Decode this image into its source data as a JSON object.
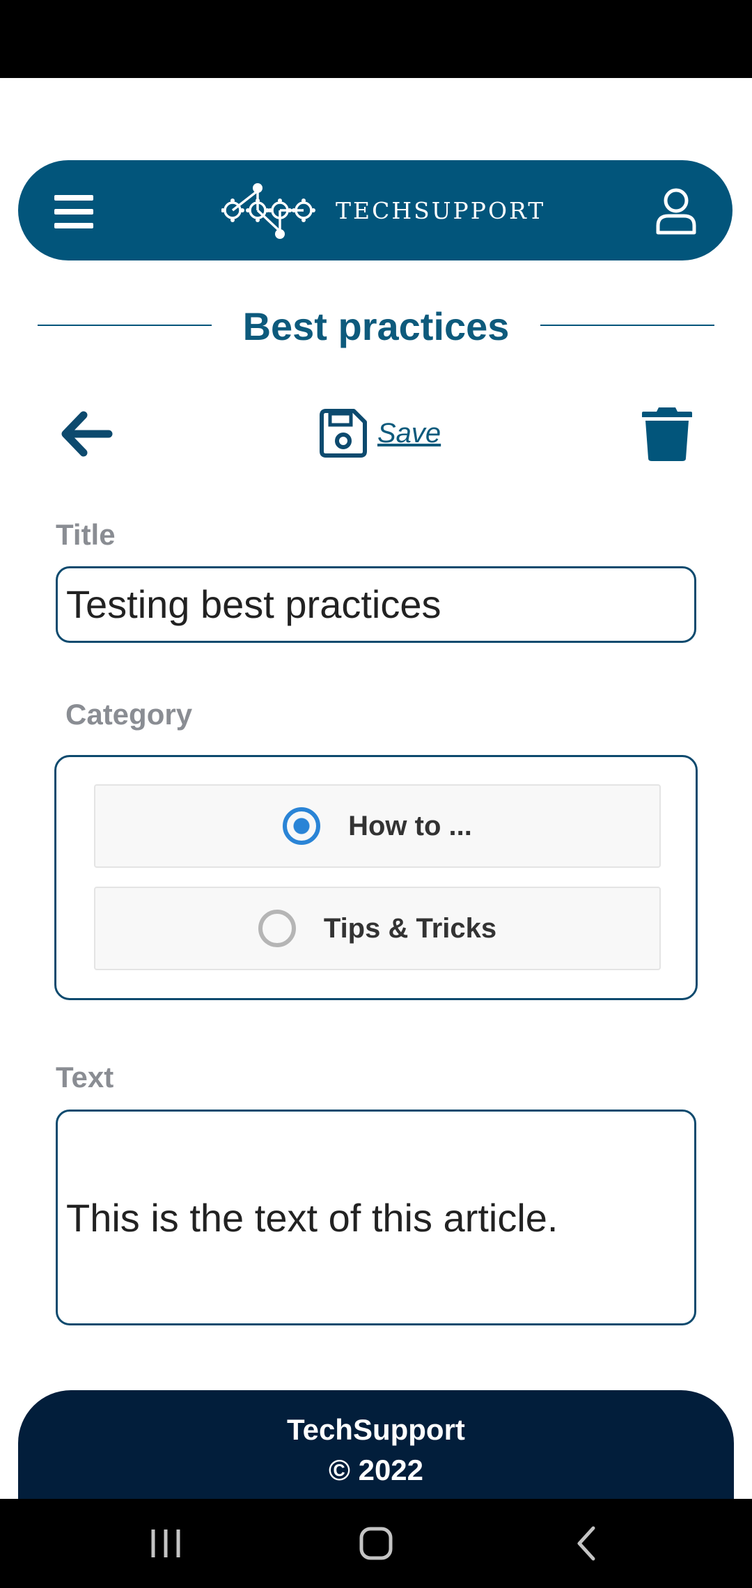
{
  "app": {
    "brand": "TECHSUPPORT",
    "page_title": "Best practices"
  },
  "toolbar": {
    "save_label": "Save"
  },
  "form": {
    "title_label": "Title",
    "title_value": "Testing best practices",
    "category_label": "Category",
    "category_options": [
      {
        "label": "How to ...",
        "selected": true
      },
      {
        "label": "Tips & Tricks",
        "selected": false
      }
    ],
    "text_label": "Text",
    "text_value": "This is the text of this article."
  },
  "footer": {
    "line1": "TechSupport",
    "line2": "© 2022"
  },
  "colors": {
    "header_bg": "#02557b",
    "footer_bg": "#021e3b",
    "accent": "#2a84d6",
    "title": "#0d5a7c"
  },
  "icons": {
    "menu": "hamburger-menu-icon",
    "user": "user-icon",
    "back": "arrow-left-icon",
    "save": "floppy-disk-icon",
    "delete": "trash-icon"
  }
}
